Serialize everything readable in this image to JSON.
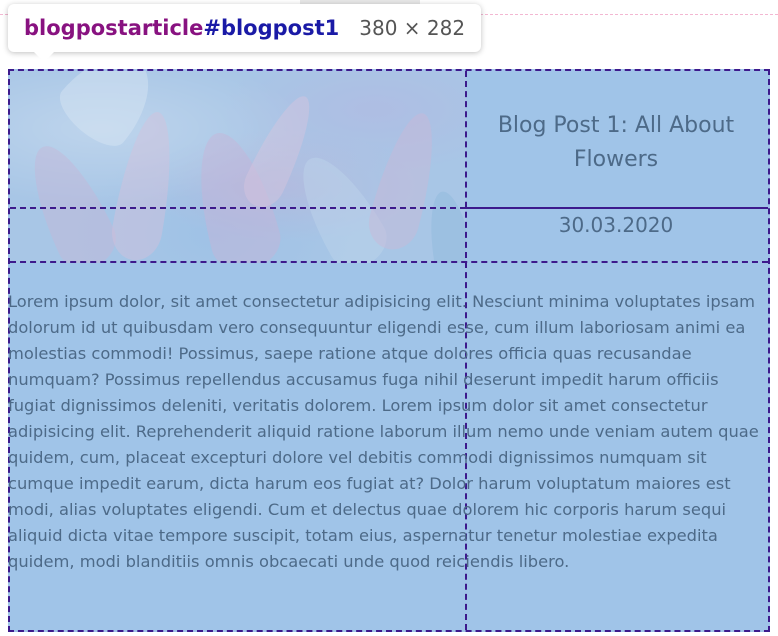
{
  "inspector_tooltip": {
    "tag": "blogpostarticle",
    "id": "#blogpost1",
    "size": "380 × 282"
  },
  "article": {
    "title": "Blog Post 1: All About Flowers",
    "date": "30.03.2020",
    "body": "Lorem ipsum dolor, sit amet consectetur adipisicing elit. Nesciunt minima voluptates ipsam dolorum id ut quibusdam vero consequuntur eligendi esse, cum illum laboriosam animi ea molestias commodi! Possimus, saepe ratione atque dolores officia quas recusandae numquam? Possimus repellendus accusamus fuga nihil deserunt impedit harum officiis fugiat dignissimos deleniti, veritatis dolorem. Lorem ipsum dolor sit amet consectetur adipisicing elit. Reprehenderit aliquid ratione laborum illum nemo unde veniam autem quae quidem, cum, placeat excepturi dolore vel debitis commodi dignissimos numquam sit cumque impedit earum, dicta harum eos fugiat at? Dolor harum voluptatum maiores est modi, alias voluptates eligendi. Cum et delectus quae dolorem hic corporis harum sequi aliquid dicta vitae tempore suscipit, totam eius, aspernatur tenetur molestiae expedita quidem, modi blanditiis omnis obcaecati unde quod reiciendis libero."
  },
  "colors": {
    "highlight": "#a0c4e8",
    "grid_lines": "#3d1a8c",
    "text": "#4d6a88",
    "tag_name": "#881280",
    "id_name": "#1a1aa6"
  }
}
